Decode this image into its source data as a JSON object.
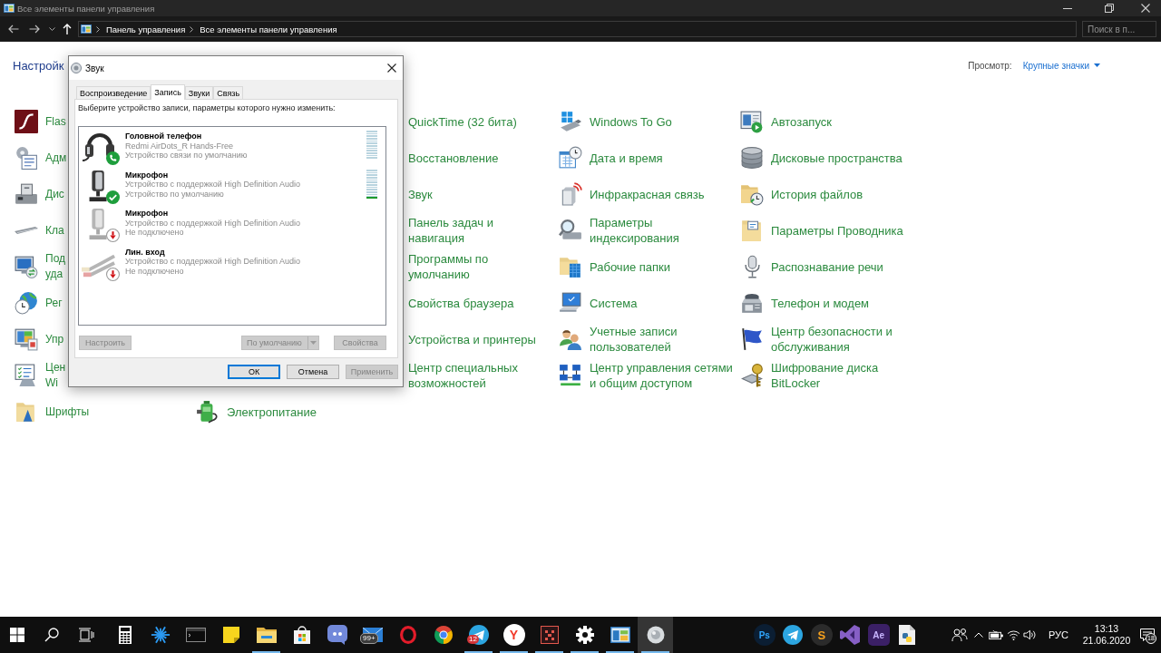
{
  "window": {
    "title": "Все элементы панели управления"
  },
  "address_bar": {
    "breadcrumb": [
      "Панель управления",
      "Все элементы панели управления"
    ]
  },
  "search": {
    "placeholder": "Поиск в п..."
  },
  "header": {
    "heading": "Настройк",
    "view_label": "Просмотр:",
    "view_value": "Крупные значки"
  },
  "grid": {
    "columns": [
      {
        "items": [
          {
            "lines": [
              "Flas"
            ]
          },
          {
            "lines": [
              "Адм"
            ]
          },
          {
            "lines": [
              "Дис"
            ]
          },
          {
            "lines": [
              "Кла"
            ]
          },
          {
            "lines": [
              "Под",
              "уда"
            ]
          },
          {
            "lines": [
              "Рег"
            ]
          },
          {
            "lines": [
              "Упр"
            ]
          },
          {
            "lines": [
              "Цен",
              "Wi"
            ]
          },
          {
            "lines": [
              "Шрифты"
            ]
          }
        ]
      },
      {
        "items": [
          {
            "lines": [
              "Электропитание"
            ]
          }
        ]
      },
      {
        "items": [
          {
            "lines": [
              "QuickTime (32 бита)"
            ]
          },
          {
            "lines": [
              "Восстановление"
            ]
          },
          {
            "lines": [
              "Звук"
            ]
          },
          {
            "lines": [
              "Панель задач и",
              "навигация"
            ]
          },
          {
            "lines": [
              "Программы по",
              "умолчанию"
            ]
          },
          {
            "lines": [
              "Свойства браузера"
            ]
          },
          {
            "lines": [
              "Устройства и принтеры"
            ]
          },
          {
            "lines": [
              "Центр специальных",
              "возможностей"
            ]
          }
        ]
      },
      {
        "items": [
          {
            "lines": [
              "Windows To Go"
            ]
          },
          {
            "lines": [
              "Дата и время"
            ]
          },
          {
            "lines": [
              "Инфракрасная связь"
            ]
          },
          {
            "lines": [
              "Параметры",
              "индексирования"
            ]
          },
          {
            "lines": [
              "Рабочие папки"
            ]
          },
          {
            "lines": [
              "Система"
            ]
          },
          {
            "lines": [
              "Учетные записи",
              "пользователей"
            ]
          },
          {
            "lines": [
              "Центр управления сетями",
              "и общим доступом"
            ]
          }
        ]
      },
      {
        "items": [
          {
            "lines": [
              "Автозапуск"
            ]
          },
          {
            "lines": [
              "Дисковые пространства"
            ]
          },
          {
            "lines": [
              "История файлов"
            ]
          },
          {
            "lines": [
              "Параметры Проводника"
            ]
          },
          {
            "lines": [
              "Распознавание речи"
            ]
          },
          {
            "lines": [
              "Телефон и модем"
            ]
          },
          {
            "lines": [
              "Центр безопасности и",
              "обслуживания"
            ]
          },
          {
            "lines": [
              "Шифрование диска",
              "BitLocker"
            ]
          }
        ]
      }
    ]
  },
  "dialog": {
    "title": "Звук",
    "tabs": [
      {
        "label": "Воспроизведение",
        "selected": false
      },
      {
        "label": "Запись",
        "selected": true
      },
      {
        "label": "Звуки",
        "selected": false
      },
      {
        "label": "Связь",
        "selected": false
      }
    ],
    "instruction": "Выберите устройство записи, параметры которого нужно изменить:",
    "devices": [
      {
        "kind": "headset",
        "name": "Головной телефон",
        "description": "Redmi AirDots_R Hands-Free",
        "status": "Устройство связи по умолчанию",
        "connected": true,
        "badge": {
          "kind": "phone"
        },
        "meter": true
      },
      {
        "kind": "microphone",
        "name": "Микрофон",
        "description": "Устройство с поддержкой High Definition Audio",
        "status": "Устройство по умолчанию",
        "connected": true,
        "badge": {
          "kind": "check"
        },
        "meter": true,
        "level": 0.09
      },
      {
        "kind": "microphone",
        "name": "Микрофон",
        "description": "Устройство с поддержкой High Definition Audio",
        "status": "Не подключено",
        "connected": false,
        "badge": {
          "kind": "unplugged"
        },
        "meter": false
      },
      {
        "kind": "line",
        "name": "Лин. вход",
        "description": "Устройство с поддержкой High Definition Audio",
        "status": "Не подключено",
        "connected": false,
        "badge": {
          "kind": "unplugged"
        },
        "meter": false
      }
    ],
    "list_buttons": [
      {
        "kind": "plain",
        "label": "Настроить",
        "disabled": true
      },
      {
        "kind": "split",
        "label": "По умолчанию",
        "disabled": true
      },
      {
        "kind": "plain",
        "label": "Свойства",
        "disabled": true
      }
    ],
    "footer_buttons": [
      {
        "label": "ОК",
        "disabled": false,
        "focused": true
      },
      {
        "label": "Отмена",
        "disabled": false,
        "focused": false
      },
      {
        "label": "Применить",
        "disabled": true,
        "focused": false
      }
    ]
  },
  "taskbar": {
    "apps": [
      {
        "kind": "icon",
        "running": false,
        "active": false
      },
      {
        "kind": "icon",
        "running": false,
        "active": false
      },
      {
        "kind": "icon",
        "running": false,
        "active": false
      },
      {
        "kind": "icon",
        "running": false,
        "active": false
      },
      {
        "kind": "icon",
        "running": true,
        "active": false
      },
      {
        "kind": "icon",
        "running": false,
        "active": false
      },
      {
        "kind": "icon",
        "running": false,
        "active": false
      },
      {
        "kind": "icon",
        "running": false,
        "active": false,
        "badge": "99+"
      },
      {
        "kind": "icon",
        "running": false,
        "active": false
      },
      {
        "kind": "icon",
        "running": false,
        "active": false
      },
      {
        "kind": "icon",
        "running": true,
        "active": false,
        "badge": "12"
      },
      {
        "kind": "glyph",
        "glyph": "Y",
        "running": true,
        "active": false
      },
      {
        "kind": "icon",
        "running": true,
        "active": false
      },
      {
        "kind": "icon",
        "running": true,
        "active": false
      },
      {
        "kind": "icon",
        "running": true,
        "active": false
      },
      {
        "kind": "icon",
        "running": true,
        "active": true
      }
    ],
    "quick_launch": [
      {
        "kind": "glyph",
        "glyph": "Ps"
      },
      {
        "kind": "icon"
      },
      {
        "kind": "glyph",
        "glyph": "S"
      },
      {
        "kind": "icon"
      },
      {
        "kind": "glyph",
        "glyph": "Ae"
      },
      {
        "kind": "icon"
      }
    ],
    "tray": {
      "language": "РУС",
      "time": "13:13",
      "date": "21.06.2020",
      "notifications": "18"
    }
  }
}
